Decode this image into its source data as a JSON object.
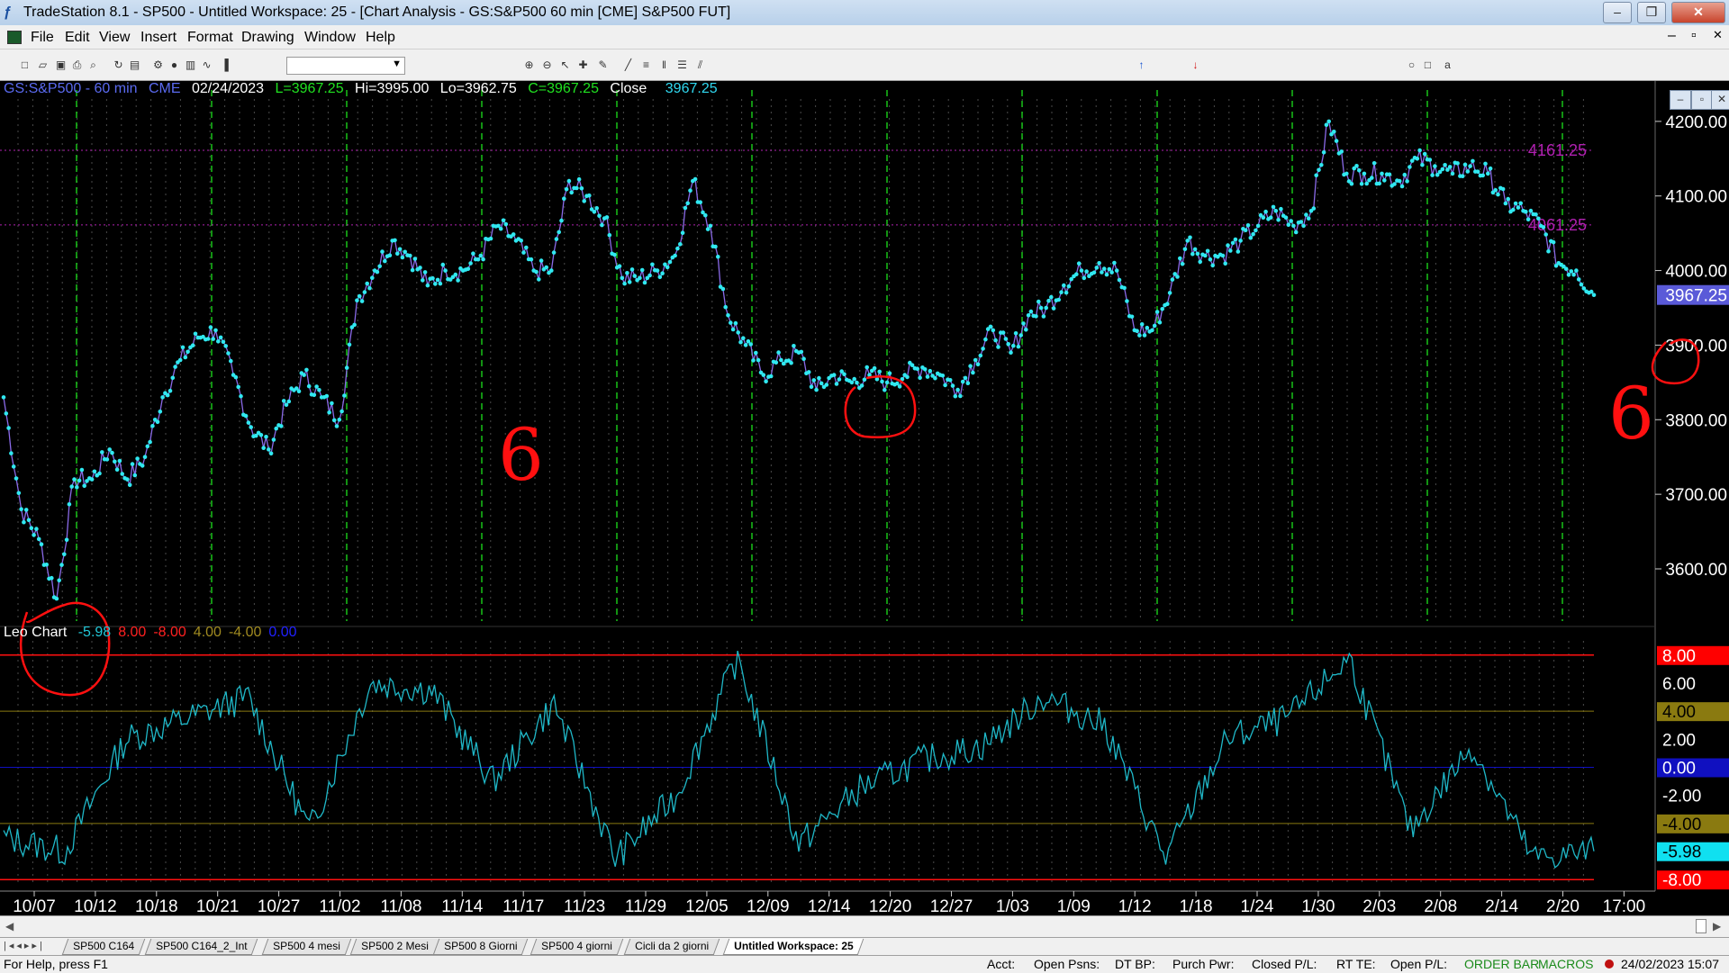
{
  "window": {
    "title": "TradeStation 8.1 - SP500 - Untitled Workspace:  25 - [Chart Analysis - GS:S&P500  60 min  [CME] S&P500 FUT]",
    "icon": "tradestation-icon",
    "minimize": "–",
    "restore": "❐",
    "close": "✕"
  },
  "menu": [
    "File",
    "Edit",
    "View",
    "Insert",
    "Format",
    "Drawing",
    "Window",
    "Help"
  ],
  "mdi_controls": [
    "–",
    "▫",
    "✕"
  ],
  "chart_window_controls": [
    "–",
    "▫",
    "✕"
  ],
  "toolbar": {
    "combo_value": "",
    "icons": [
      "new-icon",
      "open-icon",
      "save-icon",
      "print-icon",
      "print-preview-icon",
      "refresh-icon",
      "lock-icon",
      "settings-icon",
      "macro-icon",
      "chart-type-icon",
      "indicator-icon",
      "bar-chart-icon",
      "zoom-in-icon",
      "zoom-out-icon",
      "pointer-icon",
      "cursor-icon",
      "tools-icon",
      "trendline-icon",
      "horizontal-line-icon",
      "vertical-line-icon",
      "fibonacci-icon",
      "channel-icon",
      "arrow-up-icon",
      "arrow-down-icon",
      "ellipse-icon",
      "rectangle-icon",
      "text-icon"
    ]
  },
  "info_bar": {
    "symbol": "GS:S&P500 - 60 min",
    "exchange": "CME",
    "date": "02/24/2023",
    "last": "L=3967.25",
    "high": "Hi=3995.00",
    "low": "Lo=3962.75",
    "close_value": "C=3967.25",
    "close_label": "Close",
    "close_num": "3967.25"
  },
  "leo_bar": {
    "name": "Leo Chart",
    "values": [
      "-5.98",
      "8.00",
      "-8.00",
      "4.00",
      "-4.00",
      "0.00"
    ],
    "colors": [
      "#22c8d8",
      "#ff2020",
      "#ff2020",
      "#a08a20",
      "#a08a20",
      "#2020ff"
    ]
  },
  "price_axis": {
    "ticks": [
      "4200.00",
      "4100.00",
      "4000.00",
      "3900.00",
      "3800.00",
      "3700.00",
      "3600.00"
    ],
    "last_price": "3967.25",
    "last_price_bg": "#5a5ad8"
  },
  "reference_lines": [
    {
      "label": "4161.25",
      "value": 4161.25,
      "color": "#b020b0"
    },
    {
      "label": "4061.25",
      "value": 4061.25,
      "color": "#b020b0"
    }
  ],
  "osc_axis": [
    {
      "label": "8.00",
      "bg": "#ff0000",
      "fg": "#ffffff"
    },
    {
      "label": "6.00",
      "bg": "",
      "fg": "#ffffff"
    },
    {
      "label": "4.00",
      "bg": "#8a7a10",
      "fg": "#000000"
    },
    {
      "label": "2.00",
      "bg": "",
      "fg": "#ffffff"
    },
    {
      "label": "0.00",
      "bg": "#1010c0",
      "fg": "#ffffff"
    },
    {
      "label": "-2.00",
      "bg": "",
      "fg": "#ffffff"
    },
    {
      "label": "-4.00",
      "bg": "#8a7a10",
      "fg": "#000000"
    },
    {
      "label": "-5.98",
      "bg": "#10e0f0",
      "fg": "#000000"
    },
    {
      "label": "-8.00",
      "bg": "#ff0000",
      "fg": "#ffffff"
    }
  ],
  "date_axis": [
    "10/07",
    "10/12",
    "10/18",
    "10/21",
    "10/27",
    "11/02",
    "11/08",
    "11/14",
    "11/17",
    "11/23",
    "11/29",
    "12/05",
    "12/09",
    "12/14",
    "12/20",
    "12/27",
    "1/03",
    "1/09",
    "1/12",
    "1/18",
    "1/24",
    "1/30",
    "2/03",
    "2/08",
    "2/14",
    "2/20",
    "17:00"
  ],
  "annotations": {
    "cycle_label_1": "6",
    "cycle_label_2": "6",
    "ink_color": "#ff1010"
  },
  "colors": {
    "price_line": "#8a6ae8",
    "price_dots": "#30e8f0",
    "cycle_lines": "#19c319",
    "osc_line": "#1fb8c8",
    "grid_dashes": "#4a4a4a"
  },
  "chart_data": [
    {
      "type": "line",
      "title": "GS:S&P500 - 60 min",
      "x": [
        "10/07",
        "10/10",
        "10/12",
        "10/13",
        "10/14",
        "10/17",
        "10/18",
        "10/20",
        "10/21",
        "10/24",
        "10/26",
        "10/27",
        "10/28",
        "10/31",
        "11/02",
        "11/03",
        "11/04",
        "11/07",
        "11/08",
        "11/09",
        "11/10",
        "11/11",
        "11/14",
        "11/15",
        "11/16",
        "11/17",
        "11/18",
        "11/21",
        "11/23",
        "11/25",
        "11/28",
        "11/29",
        "11/30",
        "12/01",
        "12/02",
        "12/05",
        "12/06",
        "12/07",
        "12/08",
        "12/09",
        "12/12",
        "12/13",
        "12/14",
        "12/15",
        "12/16",
        "12/19",
        "12/20",
        "12/21",
        "12/22",
        "12/23",
        "12/27",
        "12/28",
        "12/29",
        "12/30",
        "1/03",
        "1/04",
        "1/05",
        "1/06",
        "1/09",
        "1/10",
        "1/11",
        "1/12",
        "1/13",
        "1/17",
        "1/18",
        "1/19",
        "1/20",
        "1/23",
        "1/24",
        "1/25",
        "1/26",
        "1/27",
        "1/30",
        "1/31",
        "2/01",
        "2/02",
        "2/03",
        "2/06",
        "2/07",
        "2/08",
        "2/09",
        "2/10",
        "2/13",
        "2/14",
        "2/15",
        "2/16",
        "2/17",
        "2/21",
        "2/22",
        "2/23",
        "2/24"
      ],
      "values": [
        3830,
        3680,
        3640,
        3560,
        3720,
        3720,
        3760,
        3720,
        3750,
        3830,
        3880,
        3910,
        3920,
        3860,
        3790,
        3760,
        3820,
        3860,
        3830,
        3800,
        3960,
        4000,
        4040,
        4020,
        3980,
        4000,
        4000,
        4020,
        4060,
        4040,
        4000,
        4000,
        4120,
        4100,
        4070,
        3990,
        3990,
        4000,
        4020,
        4120,
        4060,
        3940,
        3900,
        3860,
        3880,
        3890,
        3840,
        3860,
        3850,
        3860,
        3850,
        3860,
        3870,
        3860,
        3840,
        3880,
        3920,
        3890,
        3940,
        3950,
        3980,
        4000,
        4010,
        4000,
        3920,
        3920,
        3970,
        4040,
        4020,
        4020,
        4040,
        4060,
        4080,
        4060,
        4080,
        4200,
        4130,
        4130,
        4130,
        4120,
        4150,
        4140,
        4130,
        4140,
        4130,
        4090,
        4080,
        4060,
        4010,
        4000,
        3967.25
      ],
      "ylim": [
        3530,
        4230
      ],
      "reference_lines": [
        4161.25,
        4061.25
      ]
    },
    {
      "type": "line",
      "title": "Leo Chart",
      "x": [
        "10/07",
        "10/12",
        "10/18",
        "10/21",
        "10/27",
        "11/02",
        "11/08",
        "11/14",
        "11/17",
        "11/23",
        "11/29",
        "12/05",
        "12/09",
        "12/14",
        "12/20",
        "12/27",
        "1/03",
        "1/09",
        "1/12",
        "1/18",
        "1/24",
        "1/30",
        "2/03",
        "2/08",
        "2/14",
        "2/20",
        "2/24"
      ],
      "values": [
        -5.0,
        -6.0,
        2.0,
        3.5,
        5.0,
        -4.5,
        6.0,
        5.5,
        -1.0,
        4.5,
        -6.5,
        -2.0,
        7.8,
        -5.5,
        -1.5,
        0.5,
        1.5,
        5.0,
        3.0,
        -6.5,
        2.0,
        3.5,
        7.8,
        -4.5,
        1.5,
        -6.5,
        -5.98
      ],
      "ylim": [
        -8.5,
        8.5
      ],
      "levels": [
        8.0,
        4.0,
        0.0,
        -4.0,
        -8.0
      ]
    }
  ],
  "tabs": [
    "SP500 C164",
    "SP500 C164_2_Int",
    "SP500 4 mesi",
    "SP500  2 Mesi",
    "SP500 8 Giorni",
    "SP500 4 giorni",
    "Cicli da 2 giorni",
    "Untitled Workspace:  25"
  ],
  "status": {
    "help": "For Help, press F1",
    "acct": "Acct:",
    "open_psns": "Open Psns:",
    "dt_bp": "DT BP:",
    "purch_pwr": "Purch Pwr:",
    "closed_pl": "Closed P/L:",
    "rt_te": "RT TE:",
    "open_pl": "Open P/L:",
    "order_bar": "ORDER BAR",
    "macros": "MACROS",
    "datetime": "24/02/2023 15:07"
  }
}
